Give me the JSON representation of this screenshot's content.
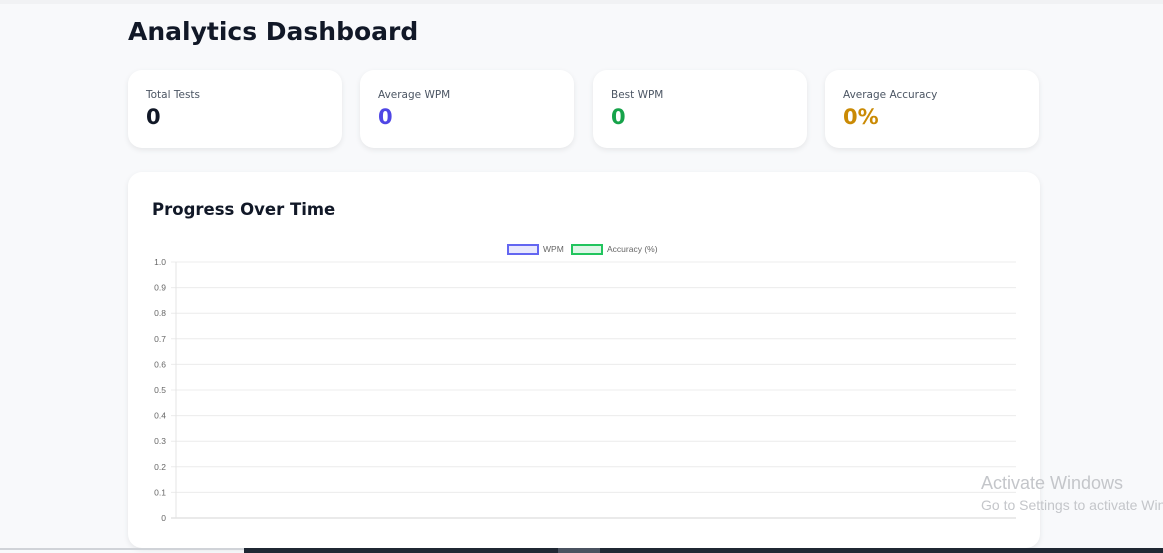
{
  "page": {
    "title": "Analytics Dashboard"
  },
  "stats": [
    {
      "label": "Total Tests",
      "value": "0",
      "color": "#111827"
    },
    {
      "label": "Average WPM",
      "value": "0",
      "color": "#4f46e5"
    },
    {
      "label": "Best WPM",
      "value": "0",
      "color": "#16a34a"
    },
    {
      "label": "Average Accuracy",
      "value": "0%",
      "color": "#ca8a04"
    }
  ],
  "progress": {
    "title": "Progress Over Time"
  },
  "chart_data": {
    "type": "line",
    "title": "Progress Over Time",
    "series": [
      {
        "name": "WPM",
        "values": [],
        "color": "#6366f1"
      },
      {
        "name": "Accuracy (%)",
        "values": [],
        "color": "#22c55e"
      }
    ],
    "x": [],
    "ylim": [
      0,
      1
    ],
    "yticks": [
      "0",
      "0.1",
      "0.2",
      "0.3",
      "0.4",
      "0.5",
      "0.6",
      "0.7",
      "0.8",
      "0.9",
      "1.0"
    ],
    "grid": true,
    "legend": "top-center"
  },
  "watermark": {
    "line1": "Activate Windows",
    "line2": "Go to Settings to activate Windows."
  }
}
